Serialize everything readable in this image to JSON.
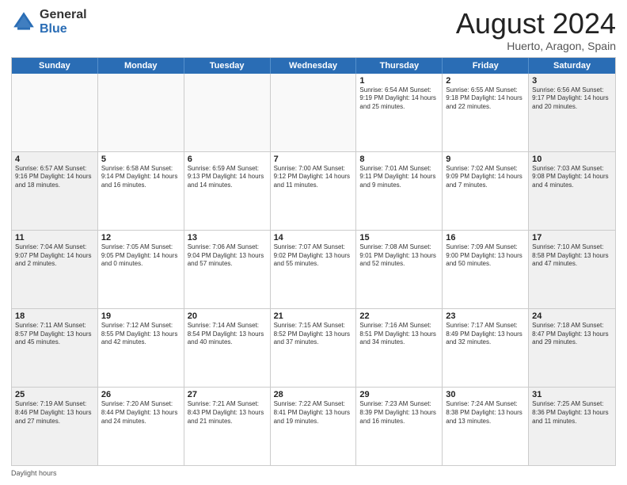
{
  "header": {
    "logo_general": "General",
    "logo_blue": "Blue",
    "title": "August 2024",
    "location": "Huerto, Aragon, Spain"
  },
  "calendar": {
    "days_of_week": [
      "Sunday",
      "Monday",
      "Tuesday",
      "Wednesday",
      "Thursday",
      "Friday",
      "Saturday"
    ],
    "weeks": [
      [
        {
          "day": "",
          "info": ""
        },
        {
          "day": "",
          "info": ""
        },
        {
          "day": "",
          "info": ""
        },
        {
          "day": "",
          "info": ""
        },
        {
          "day": "1",
          "info": "Sunrise: 6:54 AM\nSunset: 9:19 PM\nDaylight: 14 hours\nand 25 minutes."
        },
        {
          "day": "2",
          "info": "Sunrise: 6:55 AM\nSunset: 9:18 PM\nDaylight: 14 hours\nand 22 minutes."
        },
        {
          "day": "3",
          "info": "Sunrise: 6:56 AM\nSunset: 9:17 PM\nDaylight: 14 hours\nand 20 minutes."
        }
      ],
      [
        {
          "day": "4",
          "info": "Sunrise: 6:57 AM\nSunset: 9:16 PM\nDaylight: 14 hours\nand 18 minutes."
        },
        {
          "day": "5",
          "info": "Sunrise: 6:58 AM\nSunset: 9:14 PM\nDaylight: 14 hours\nand 16 minutes."
        },
        {
          "day": "6",
          "info": "Sunrise: 6:59 AM\nSunset: 9:13 PM\nDaylight: 14 hours\nand 14 minutes."
        },
        {
          "day": "7",
          "info": "Sunrise: 7:00 AM\nSunset: 9:12 PM\nDaylight: 14 hours\nand 11 minutes."
        },
        {
          "day": "8",
          "info": "Sunrise: 7:01 AM\nSunset: 9:11 PM\nDaylight: 14 hours\nand 9 minutes."
        },
        {
          "day": "9",
          "info": "Sunrise: 7:02 AM\nSunset: 9:09 PM\nDaylight: 14 hours\nand 7 minutes."
        },
        {
          "day": "10",
          "info": "Sunrise: 7:03 AM\nSunset: 9:08 PM\nDaylight: 14 hours\nand 4 minutes."
        }
      ],
      [
        {
          "day": "11",
          "info": "Sunrise: 7:04 AM\nSunset: 9:07 PM\nDaylight: 14 hours\nand 2 minutes."
        },
        {
          "day": "12",
          "info": "Sunrise: 7:05 AM\nSunset: 9:05 PM\nDaylight: 14 hours\nand 0 minutes."
        },
        {
          "day": "13",
          "info": "Sunrise: 7:06 AM\nSunset: 9:04 PM\nDaylight: 13 hours\nand 57 minutes."
        },
        {
          "day": "14",
          "info": "Sunrise: 7:07 AM\nSunset: 9:02 PM\nDaylight: 13 hours\nand 55 minutes."
        },
        {
          "day": "15",
          "info": "Sunrise: 7:08 AM\nSunset: 9:01 PM\nDaylight: 13 hours\nand 52 minutes."
        },
        {
          "day": "16",
          "info": "Sunrise: 7:09 AM\nSunset: 9:00 PM\nDaylight: 13 hours\nand 50 minutes."
        },
        {
          "day": "17",
          "info": "Sunrise: 7:10 AM\nSunset: 8:58 PM\nDaylight: 13 hours\nand 47 minutes."
        }
      ],
      [
        {
          "day": "18",
          "info": "Sunrise: 7:11 AM\nSunset: 8:57 PM\nDaylight: 13 hours\nand 45 minutes."
        },
        {
          "day": "19",
          "info": "Sunrise: 7:12 AM\nSunset: 8:55 PM\nDaylight: 13 hours\nand 42 minutes."
        },
        {
          "day": "20",
          "info": "Sunrise: 7:14 AM\nSunset: 8:54 PM\nDaylight: 13 hours\nand 40 minutes."
        },
        {
          "day": "21",
          "info": "Sunrise: 7:15 AM\nSunset: 8:52 PM\nDaylight: 13 hours\nand 37 minutes."
        },
        {
          "day": "22",
          "info": "Sunrise: 7:16 AM\nSunset: 8:51 PM\nDaylight: 13 hours\nand 34 minutes."
        },
        {
          "day": "23",
          "info": "Sunrise: 7:17 AM\nSunset: 8:49 PM\nDaylight: 13 hours\nand 32 minutes."
        },
        {
          "day": "24",
          "info": "Sunrise: 7:18 AM\nSunset: 8:47 PM\nDaylight: 13 hours\nand 29 minutes."
        }
      ],
      [
        {
          "day": "25",
          "info": "Sunrise: 7:19 AM\nSunset: 8:46 PM\nDaylight: 13 hours\nand 27 minutes."
        },
        {
          "day": "26",
          "info": "Sunrise: 7:20 AM\nSunset: 8:44 PM\nDaylight: 13 hours\nand 24 minutes."
        },
        {
          "day": "27",
          "info": "Sunrise: 7:21 AM\nSunset: 8:43 PM\nDaylight: 13 hours\nand 21 minutes."
        },
        {
          "day": "28",
          "info": "Sunrise: 7:22 AM\nSunset: 8:41 PM\nDaylight: 13 hours\nand 19 minutes."
        },
        {
          "day": "29",
          "info": "Sunrise: 7:23 AM\nSunset: 8:39 PM\nDaylight: 13 hours\nand 16 minutes."
        },
        {
          "day": "30",
          "info": "Sunrise: 7:24 AM\nSunset: 8:38 PM\nDaylight: 13 hours\nand 13 minutes."
        },
        {
          "day": "31",
          "info": "Sunrise: 7:25 AM\nSunset: 8:36 PM\nDaylight: 13 hours\nand 11 minutes."
        }
      ]
    ]
  },
  "footer": {
    "note": "Daylight hours"
  }
}
